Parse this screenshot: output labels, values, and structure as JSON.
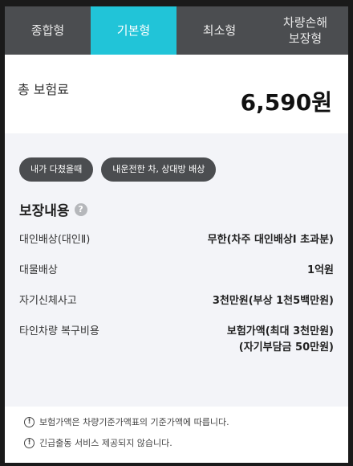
{
  "tabs": [
    {
      "label": "종합형",
      "active": false
    },
    {
      "label": "기본형",
      "active": true
    },
    {
      "label": "최소형",
      "active": false
    },
    {
      "label": "차량손해\n보장형",
      "active": false
    }
  ],
  "premium": {
    "label": "총 보험료",
    "value": "6,590원"
  },
  "chips": [
    "내가 다쳤을때",
    "내운전한 차, 상대방 배상"
  ],
  "coverage": {
    "title": "보장내용",
    "help_icon": "question-circle-icon",
    "rows": [
      {
        "label": "대인배상(대인Ⅱ)",
        "value": "무한(차주 대인배상Ⅰ 초과분)"
      },
      {
        "label": "대물배상",
        "value": "1억원"
      },
      {
        "label": "자기신체사고",
        "value": "3천만원(부상 1천5백만원)"
      },
      {
        "label": "타인차량 복구비용",
        "value": "보험가액(최대 3천만원)\n(자기부담금 50만원)"
      }
    ]
  },
  "notes": [
    "보험가액은 차량기준가액표의 기준가액에 따릅니다.",
    "긴급출동 서비스 제공되지 않습니다."
  ],
  "colors": {
    "tab_bar": "#4b4d50",
    "tab_active": "#21c4d8",
    "section_bg": "#f3f4f8"
  }
}
